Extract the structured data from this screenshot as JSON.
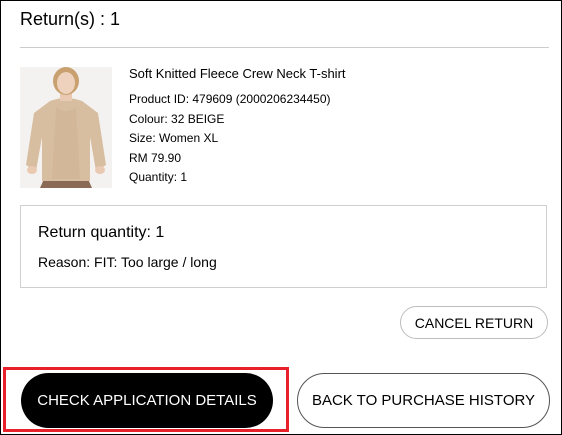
{
  "returns_heading": "Return(s) : 1",
  "product": {
    "name": "Soft Knitted Fleece Crew Neck T-shirt",
    "product_id": "Product ID: 479609 (2000206234450)",
    "colour": "Colour: 32 BEIGE",
    "size": "Size: Women XL",
    "price": "RM 79.90",
    "quantity": "Quantity: 1",
    "image_icon": "product-photo-sweater-model"
  },
  "return_details": {
    "quantity": "Return quantity: 1",
    "reason": "Reason: FIT: Too large / long"
  },
  "actions": {
    "cancel_return": "CANCEL RETURN",
    "check_application": "CHECK APPLICATION DETAILS",
    "back_to_history": "BACK TO PURCHASE HISTORY"
  },
  "colors": {
    "primary_button": "#000000",
    "highlight": "#e8202a"
  }
}
